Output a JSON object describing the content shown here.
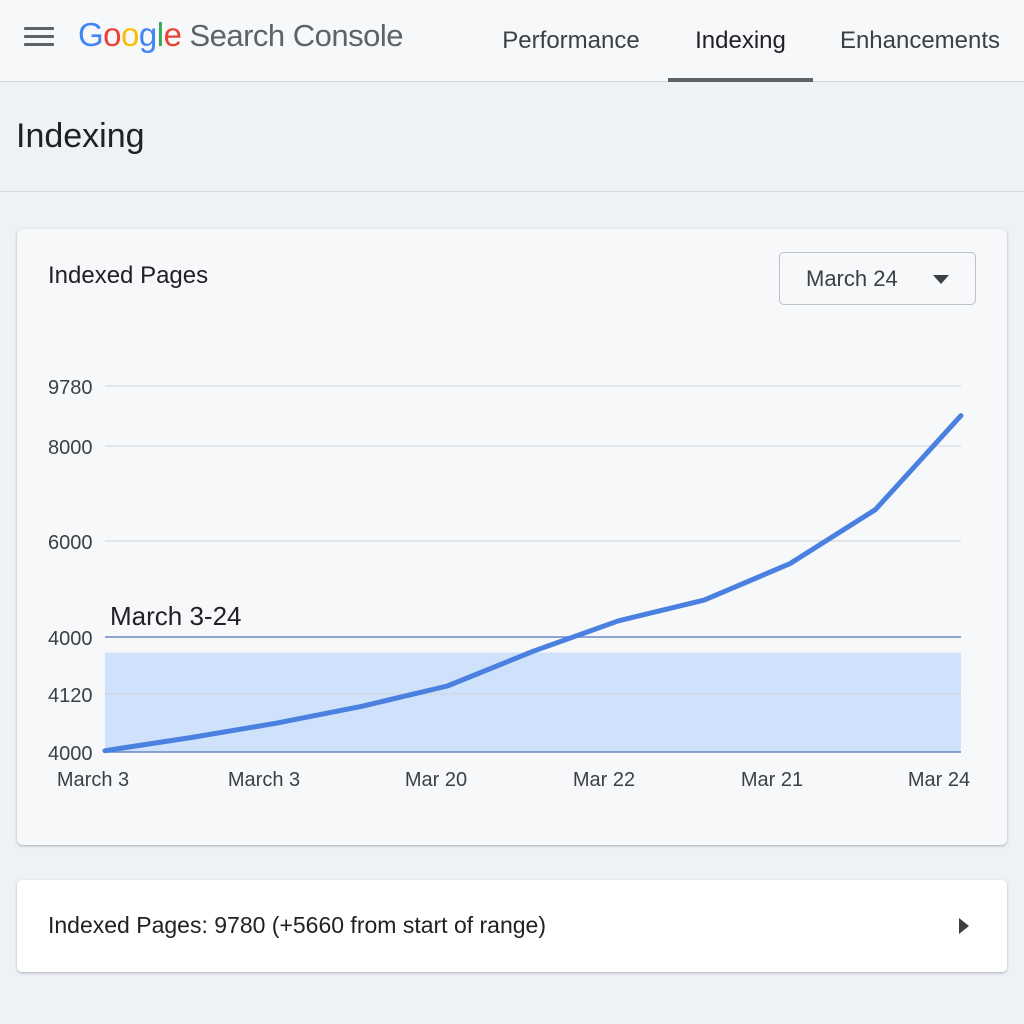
{
  "app": {
    "logo_letters": [
      {
        "ch": "G",
        "color": "#4285F4"
      },
      {
        "ch": "o",
        "color": "#EA4335"
      },
      {
        "ch": "o",
        "color": "#FBBC05"
      },
      {
        "ch": "g",
        "color": "#4285F4"
      },
      {
        "ch": "l",
        "color": "#34A853"
      },
      {
        "ch": "e",
        "color": "#EA4335"
      }
    ],
    "product_name": "Search Console"
  },
  "nav": {
    "tabs": [
      {
        "label": "Performance",
        "active": false
      },
      {
        "label": "Indexing",
        "active": true
      },
      {
        "label": "Enhancements",
        "active": false
      }
    ]
  },
  "page": {
    "title": "Indexing"
  },
  "card": {
    "title": "Indexed Pages",
    "date_select": {
      "selected": "March 24"
    }
  },
  "chart_data": {
    "type": "line",
    "y_tick_labels": [
      "9780",
      "8000",
      "6000",
      "4000",
      "4120",
      "4000"
    ],
    "x_tick_labels": [
      "March 3",
      "March 3",
      "Mar 20",
      "Mar 22",
      "Mar 21",
      "Mar 24"
    ],
    "x": [
      0,
      1,
      2,
      3,
      4,
      5,
      6,
      7,
      8,
      9,
      10
    ],
    "series": [
      {
        "values": [
          3680,
          3990,
          4330,
          4730,
          5210,
          6030,
          6750,
          7240,
          8100,
          9380,
          11600
        ],
        "color": "#4a80e0"
      }
    ],
    "ylim": [
      3650,
      12300
    ],
    "highlight_band": {
      "label": "March 3-24",
      "from": 3650,
      "to": 6000
    },
    "grid": true
  },
  "summary": {
    "text": "Indexed Pages: 9780 (+5660 from start of range)"
  },
  "colors": {
    "line": "#4a80e0",
    "band": "#d0e2fb",
    "grid": "#cfd3d8",
    "band_edge": "#6b89c4"
  }
}
